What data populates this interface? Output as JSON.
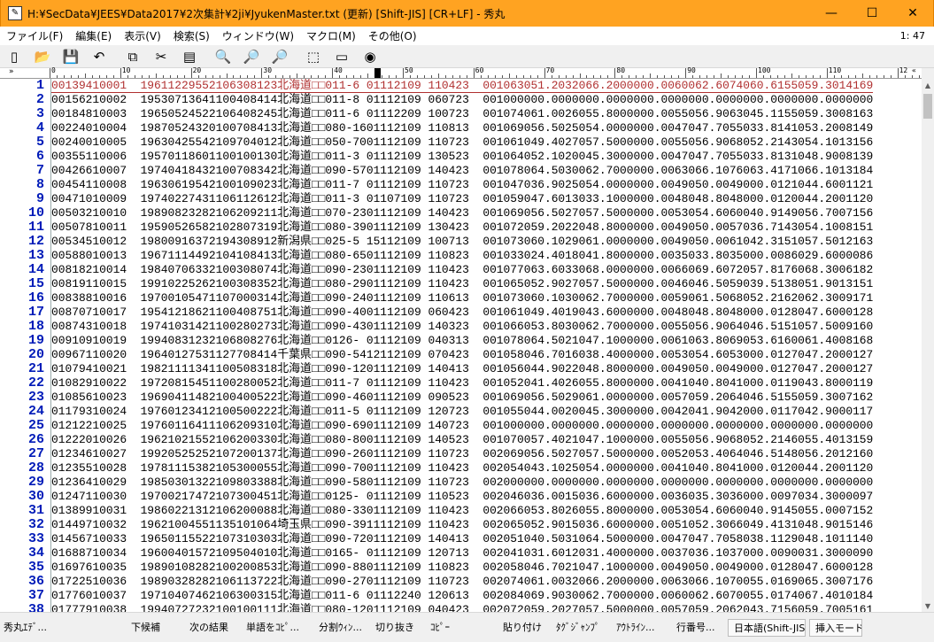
{
  "window": {
    "title": "H:¥SecData¥JEES¥Data2017¥2次集計¥2ji¥JyukenMaster.txt (更新) [Shift-JIS] [CR+LF] - 秀丸",
    "minimize": "—",
    "maximize": "☐",
    "close": "✕",
    "accent": "#ffa321"
  },
  "menu": {
    "items": [
      "ファイル(F)",
      "編集(E)",
      "表示(V)",
      "検索(S)",
      "ウィンドウ(W)",
      "マクロ(M)",
      "その他(O)"
    ],
    "clock": "1: 47"
  },
  "toolbar": {
    "icons": [
      "new-file-icon",
      "open-folder-icon",
      "save-icon",
      "undo-icon",
      "copy-icon",
      "cut-icon",
      "paste-icon",
      "search-icon",
      "find-next-icon",
      "find-prev-icon",
      "tag-jump-icon",
      "window-split-icon",
      "help-icon"
    ],
    "glyphs": [
      "▯",
      "📂",
      "💾",
      "↶",
      "⧉",
      "✂",
      "▤",
      "🔍",
      "🔎",
      "🔎",
      "⬚",
      "▭",
      "◉"
    ]
  },
  "ruler": {
    "corner": "»",
    "labels": [
      "0",
      "10",
      "20",
      "30",
      "40",
      "50",
      "60",
      "70",
      "80",
      "90",
      "100",
      "110",
      "12"
    ],
    "end_marker": "«"
  },
  "editor": {
    "line_numbers": [
      "1",
      "2",
      "3",
      "4",
      "5",
      "6",
      "7",
      "8",
      "9",
      "10",
      "11",
      "12",
      "13",
      "14",
      "15",
      "16",
      "17",
      "18",
      "19",
      "20",
      "21",
      "22",
      "23",
      "24",
      "25",
      "26",
      "27",
      "28",
      "29",
      "30",
      "31",
      "32",
      "33",
      "34",
      "35",
      "36",
      "37",
      "38"
    ],
    "lines": [
      "00139410001  19611229552106308123北海道□□011-6 01112109 110423  001063051.2032066.2000000.0060062.6074060.6155059.3014169",
      "00156210002  19530713641100408414北海道□□011-8 01112109 060723  001000000.0000000.0000000.0000000.0000000.0000000.0000000",
      "00184810003  19650524522106408245北海道□□011-6 01112209 100723  001074061.0026055.8000000.0055056.9063045.1155059.3008163",
      "00224010004  19870524320100708413北海道□□080-1601112109 110813  001069056.5025054.0000000.0047047.7055033.8141053.2008149",
      "00240010005  19630425542109704012北海道□□050-7001112109 110723  001061049.4027057.5000000.0055056.9068052.2143054.1013156",
      "00355110006  19570118601100100130北海道□□011-3 01112109 130523  001064052.1020045.3000000.0047047.7055033.8131048.9008139",
      "00426610007  19740418432100708342北海道□□090-5701112109 140423  001078064.5030062.7000000.0063066.1076063.4171066.1013184",
      "00454110008  19630619542100109023北海道□□011-7 01112109 110723  001047036.9025054.0000000.0049050.0049000.0121044.6001121",
      "00471010009  19740227431106112612北海道□□011-3 01107109 110723  001059047.6013033.1000000.0048048.8048000.0120044.2001120",
      "00503210010  19890823282106209211北海道□□070-2301112109 140423  001069056.5027057.5000000.0053054.6060040.9149056.7007156",
      "00507810011  19590526582102807319北海道□□080-3901112109 130423  001072059.2022048.8000000.0049050.0057036.7143054.1008151",
      "00534510012  19800916372194308912新潟県□□025-5 15112109 100713  001073060.1029061.0000000.0049050.0061042.3151057.5012163",
      "00588010013  19671114492104108413北海道□□080-6501112109 110823  001033024.4018041.8000000.0035033.8035000.0086029.6000086",
      "00818210014  19840706332100308074北海道□□090-2301112109 110423  001077063.6033068.0000000.0066069.6072057.8176068.3006182",
      "00819110015  19910225262100308352北海道□□080-2901112109 110423  001065052.9027057.5000000.0046046.5059039.5138051.9013151",
      "00838810016  19700105471107000314北海道□□090-2401112109 110613  001073060.1030062.7000000.0059061.5068052.2162062.3009171",
      "00870710017  19541218621100408751北海道□□090-4001112109 060423  001061049.4019043.6000000.0048048.8048000.0128047.6000128",
      "00874310018  19741031421100280273北海道□□090-4301112109 140323  001066053.8030062.7000000.0055056.9064046.5151057.5009160",
      "00910910019  19940831232106808276北海道□□0126- 01112109 040313  001078064.5021047.1000000.0061063.8069053.6160061.4008168",
      "00967110020  19640127531127708414千葉県□□090-5412112109 070423  001058046.7016038.4000000.0053054.6053000.0127047.2000127",
      "01079410021  19821111341100508318北海道□□090-1201112109 140413  001056044.9022048.8000000.0049050.0049000.0127047.2000127",
      "01082910022  19720815451100280052北海道□□011-7 01112109 110423  001052041.4026055.8000000.0041040.8041000.0119043.8000119",
      "01085610023  19690411482100400522北海道□□090-4601112109 090523  001069056.5029061.0000000.0057059.2064046.5155059.3007162",
      "01179310024  19760123412100500222北海道□□011-5 01112109 120723  001055044.0020045.3000000.0042041.9042000.0117042.9000117",
      "01212210025  19760116411106209310北海道□□090-6901112109 140723  001000000.0000000.0000000.0000000.0000000.0000000.0000000",
      "01222010026  19621021552106200330北海道□□080-8001112109 140523  001070057.4021047.1000000.0055056.9068052.2146055.4013159",
      "01234610027  19920525252107200137北海道□□090-2601112109 110723  002069056.5027057.5000000.0052053.4064046.5148056.2012160",
      "01235510028  19781115382105300055北海道□□090-7001112109 110423  002054043.1025054.0000000.0041040.8041000.0120044.2001120",
      "01236410029  19850301322109803388北海道□□090-5801112109 110723  002000000.0000000.0000000.0000000.0000000.0000000.0000000",
      "01247110030  19700217472107300451北海道□□0125- 01112109 110523  002046036.0015036.6000000.0036035.3036000.0097034.3000097",
      "01389910031  19860221312106200088北海道□□080-3301112109 110423  002066053.8026055.8000000.0053054.6060040.9145055.0007152",
      "01449710032  19621004551135101064埼玉県□□090-3911112109 110423  002065052.9015036.6000000.0051052.3066049.4131048.9015146",
      "01456710033  19650115522107310303北海道□□090-7201112109 140413  002051040.5031064.5000000.0047047.7058038.1129048.1011140",
      "01688710034  19600401572109504010北海道□□0165- 01112109 120713  002041031.6012031.4000000.0037036.1037000.0090031.3000090",
      "01697610035  19890108282100200853北海道□□090-8801112109 110823  002058046.7021047.1000000.0049050.0049000.0128047.6000128",
      "01722510036  19890328282106113722北海道□□090-2701112109 110723  002074061.0032066.2000000.0063066.1070055.0169065.3007176",
      "01776010037  19710407462106300315北海道□□011-6 01112240 120613  002084069.9030062.7000000.0060062.6070055.0174067.4010184",
      "01777910038  19940727232100100111北海道□□080-1201112109 040423  002072059.2027057.5000000.0057059.2062043.7156059.7005161"
    ],
    "current_line": 1,
    "text_color": "#000000",
    "current_color": "#b03030",
    "line_number_color": "#001bb8"
  },
  "statusbar": {
    "items": [
      "秀丸ｴﾃﾞ...",
      "",
      "下候補",
      "次の結果",
      "単語をｺﾋﾟ...",
      "分割ｳｨﾝ...",
      "切り抜き",
      "ｺﾋﾟｰ",
      "",
      "貼り付け",
      "ﾀｸﾞｼﾞｬﾝﾌﾟ",
      "ｱｳﾄﾗｲﾝ...",
      "行番号...",
      "日本語(Shift-JIS)",
      "挿入モード"
    ]
  }
}
